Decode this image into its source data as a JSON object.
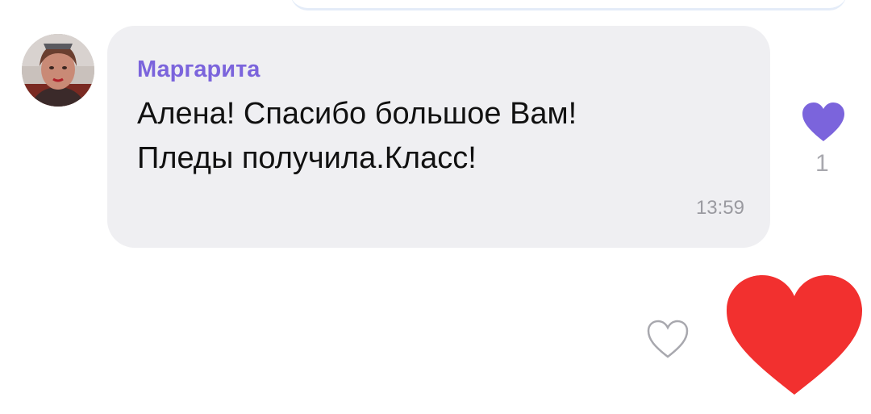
{
  "message": {
    "sender": "Маргарита",
    "text_lines": [
      "Алена! Спасибо большое Вам!",
      "Пледы получила.Класс!"
    ],
    "time": "13:59"
  },
  "reactions": {
    "icon": "heart-icon",
    "count": "1",
    "color": "#7b64dc"
  },
  "actions": {
    "like_icon": "heart-outline-icon",
    "big_heart_icon": "heart-icon",
    "big_heart_color": "#f2302f"
  },
  "colors": {
    "bubble_bg": "#efeff2",
    "sender_name": "#7b64dc",
    "time_text": "#9a9aa0"
  }
}
